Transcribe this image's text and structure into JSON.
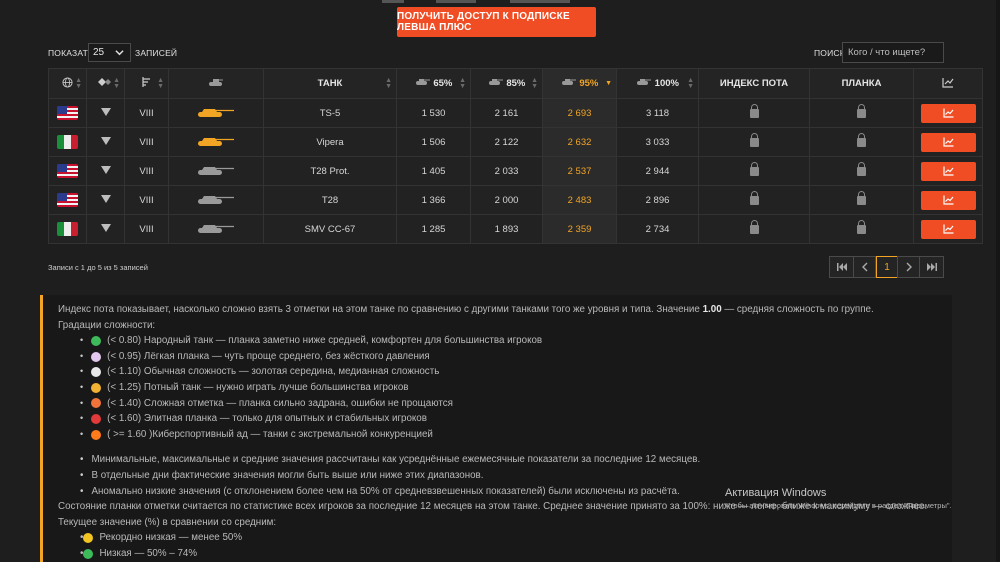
{
  "cta": {
    "label": "ПОЛУЧИТЬ ДОСТУП К ПОДПИСКЕ ЛЕВША ПЛЮС"
  },
  "controls": {
    "show_label": "ПОКАЗАТЬ",
    "page_size": "25",
    "entries_label": "ЗАПИСЕЙ",
    "search_label": "ПОИСК:",
    "search_placeholder": "Кого / что ищете?"
  },
  "table": {
    "headers": {
      "nation": "",
      "type": "",
      "tier": "",
      "image": "",
      "tank": "ТАНК",
      "p65": "65%",
      "p85": "85%",
      "p95": "95%",
      "p100": "100%",
      "sweat": "ИНДЕКС ПОТА",
      "bar": "ПЛАНКА",
      "chart": ""
    },
    "sorted_column": "p95",
    "rows": [
      {
        "nation": "usa",
        "tier": "VIII",
        "name": "TS-5",
        "p65": "1 530",
        "p85": "2 161",
        "p95": "2 693",
        "p100": "3 118",
        "icon_color": "#f2a524"
      },
      {
        "nation": "italy",
        "tier": "VIII",
        "name": "Vipera",
        "p65": "1 506",
        "p85": "2 122",
        "p95": "2 632",
        "p100": "3 033",
        "icon_color": "#f2a524"
      },
      {
        "nation": "usa",
        "tier": "VIII",
        "name": "T28 Prot.",
        "p65": "1 405",
        "p85": "2 033",
        "p95": "2 537",
        "p100": "2 944",
        "icon_color": "#9a9a9a"
      },
      {
        "nation": "usa",
        "tier": "VIII",
        "name": "T28",
        "p65": "1 366",
        "p85": "2 000",
        "p95": "2 483",
        "p100": "2 896",
        "icon_color": "#9a9a9a"
      },
      {
        "nation": "italy",
        "tier": "VIII",
        "name": "SMV CC-67",
        "p65": "1 285",
        "p85": "1 893",
        "p95": "2 359",
        "p100": "2 734",
        "icon_color": "#9a9a9a"
      }
    ]
  },
  "records_info": "Записи с 1 до 5 из 5 записей",
  "pagination": {
    "first": "⏮",
    "prev": "‹",
    "current": "1",
    "next": "›",
    "last": "⏭"
  },
  "info": {
    "intro_before": "Индекс пота показывает, насколько сложно взять 3 отметки на этом танке по сравнению с другими танками того же уровня и типа. Значение ",
    "intro_bold": "1.00",
    "intro_after": " — средняя сложность по группе.",
    "grades_title": "Градации сложности:",
    "grades": [
      {
        "text": "(< 0.80) Народный танк — планка заметно ниже средней, комфортен для большинства игроков",
        "color": "#3dba5a"
      },
      {
        "text": "(< 0.95) Лёгкая планка — чуть проще среднего, без жёсткого давления",
        "color": "#e2c8ee"
      },
      {
        "text": "(< 1.10) Обычная сложность — золотая середина, медианная сложность",
        "color": "#e8e8e8"
      },
      {
        "text": "(< 1.25) Потный танк — нужно играть лучше большинства игроков",
        "color": "#f2b233"
      },
      {
        "text": "(< 1.40) Сложная отметка — планка сильно задрана, ошибки не прощаются",
        "color": "#f0743a"
      },
      {
        "text": "(< 1.60) Элитная планка — только для опытных и стабильных игроков",
        "color": "#e03a3a"
      },
      {
        "text": "( >= 1.60 )Киберспортивный ад — танки с экстремальной конкуренцией",
        "color": "#ff7a1a"
      }
    ],
    "notes": [
      "Минимальные, максимальные и средние значения рассчитаны как усреднённые ежемесячные показатели за последние 12 месяцев.",
      "В отдельные дни фактические значения могли быть выше или ниже этих диапазонов.",
      "Аномально низкие значения (с отклонением более чем на 50% от средневзвешенных показателей) были исключены из расчёта."
    ],
    "bar_text": "Состояние планки отметки считается по статистике всех игроков за последние 12 месяцев на этом танке. Среднее значение принято за 100%: ниже — легче, ближе к максимуму — сложнее.",
    "current_title": "Текущее значение (%) в сравнении со средним:",
    "current": [
      {
        "text": "Рекордно низкая — менее 50%",
        "color": "#f2c522"
      },
      {
        "text": "Низкая — 50% – 74%",
        "color": "#3dba5a"
      }
    ]
  },
  "windows": {
    "title": "Активация Windows",
    "subtitle": "Чтобы активировать Windows, перейдите в раздел \"Параметры\"."
  }
}
